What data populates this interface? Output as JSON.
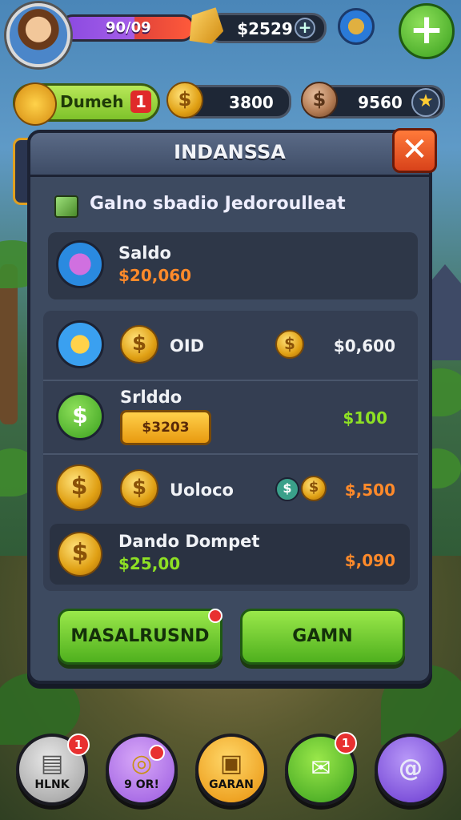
{
  "top_bar": {
    "xp_value": "90/09",
    "gems_value": "$2529",
    "plus_symbol": "+",
    "big_plus": "+"
  },
  "second_bar": {
    "button_label": "Dumeh",
    "button_badge": "1",
    "gold_value": "3800",
    "silver_value": "9560"
  },
  "dialog": {
    "title": "INDANSSA",
    "close_symbol": "✕",
    "subtitle": "Galno sbadio Jedoroulleat",
    "balance": {
      "label": "Saldo",
      "value": "$20,060"
    },
    "rows": [
      {
        "label": "OID",
        "value": "$0,600"
      },
      {
        "label": "Srlddo",
        "button": "$3203",
        "value": "$100"
      },
      {
        "label": "Uoloco",
        "value": "$,500"
      },
      {
        "label": "Dando Dompet",
        "sub_value": "$25,00",
        "value": "$,090"
      }
    ],
    "buttons": {
      "left": "MASALRUSND",
      "right": "GAMN"
    }
  },
  "bottom_nav": [
    {
      "label": "HLNK",
      "badge": "1",
      "icon": "document-icon"
    },
    {
      "label": "9 OR!",
      "badge": "",
      "icon": "target-icon"
    },
    {
      "label": "GARAN",
      "badge": "",
      "icon": "card-icon"
    },
    {
      "label": "",
      "badge": "1",
      "icon": "message-icon"
    },
    {
      "label": "",
      "badge": "",
      "icon": "swirl-icon"
    }
  ],
  "colors": {
    "green_value": "#8ee024",
    "orange_value": "#ff8a2a",
    "panel": "#3d4a60"
  }
}
